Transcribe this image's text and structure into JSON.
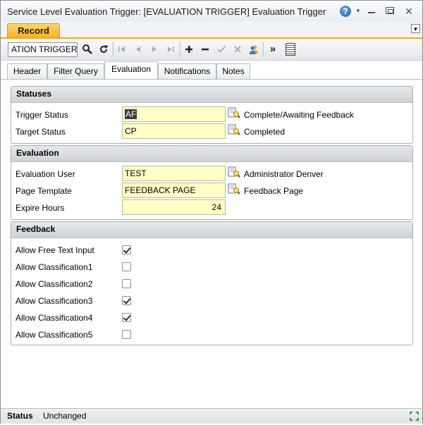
{
  "window": {
    "title": "Service Level Evaluation Trigger: [EVALUATION TRIGGER] Evaluation Trigger",
    "help_glyph": "?",
    "close_glyph": "✕"
  },
  "record_tab": {
    "label": "Record"
  },
  "toolbar": {
    "key_value": "ATION TRIGGER"
  },
  "tabs": [
    {
      "label": "Header",
      "active": false
    },
    {
      "label": "Filter Query",
      "active": false
    },
    {
      "label": "Evaluation",
      "active": true
    },
    {
      "label": "Notifications",
      "active": false
    },
    {
      "label": "Notes",
      "active": false
    }
  ],
  "statuses": {
    "title": "Statuses",
    "rows": [
      {
        "label": "Trigger Status",
        "value": "AF",
        "desc": "Complete/Awaiting Feedback"
      },
      {
        "label": "Target Status",
        "value": "CP",
        "desc": "Completed"
      }
    ]
  },
  "evaluation": {
    "title": "Evaluation",
    "rows": [
      {
        "label": "Evaluation User",
        "value": "TEST",
        "desc": "Administrator Denver"
      },
      {
        "label": "Page Template",
        "value": "FEEDBACK PAGE",
        "desc": "Feedback Page"
      },
      {
        "label": "Expire Hours",
        "value": "24"
      }
    ]
  },
  "feedback": {
    "title": "Feedback",
    "rows": [
      {
        "label": "Allow Free Text Input",
        "checked": true
      },
      {
        "label": "Allow Classification1",
        "checked": false
      },
      {
        "label": "Allow Classification2",
        "checked": false
      },
      {
        "label": "Allow Classification3",
        "checked": true
      },
      {
        "label": "Allow Classification4",
        "checked": true
      },
      {
        "label": "Allow Classification5",
        "checked": false
      }
    ]
  },
  "status_bar": {
    "label": "Status",
    "value": "Unchanged"
  },
  "colors": {
    "accent": "#f8b324",
    "field_bg": "#ffffc6",
    "section_head": "#d9dcdf"
  }
}
